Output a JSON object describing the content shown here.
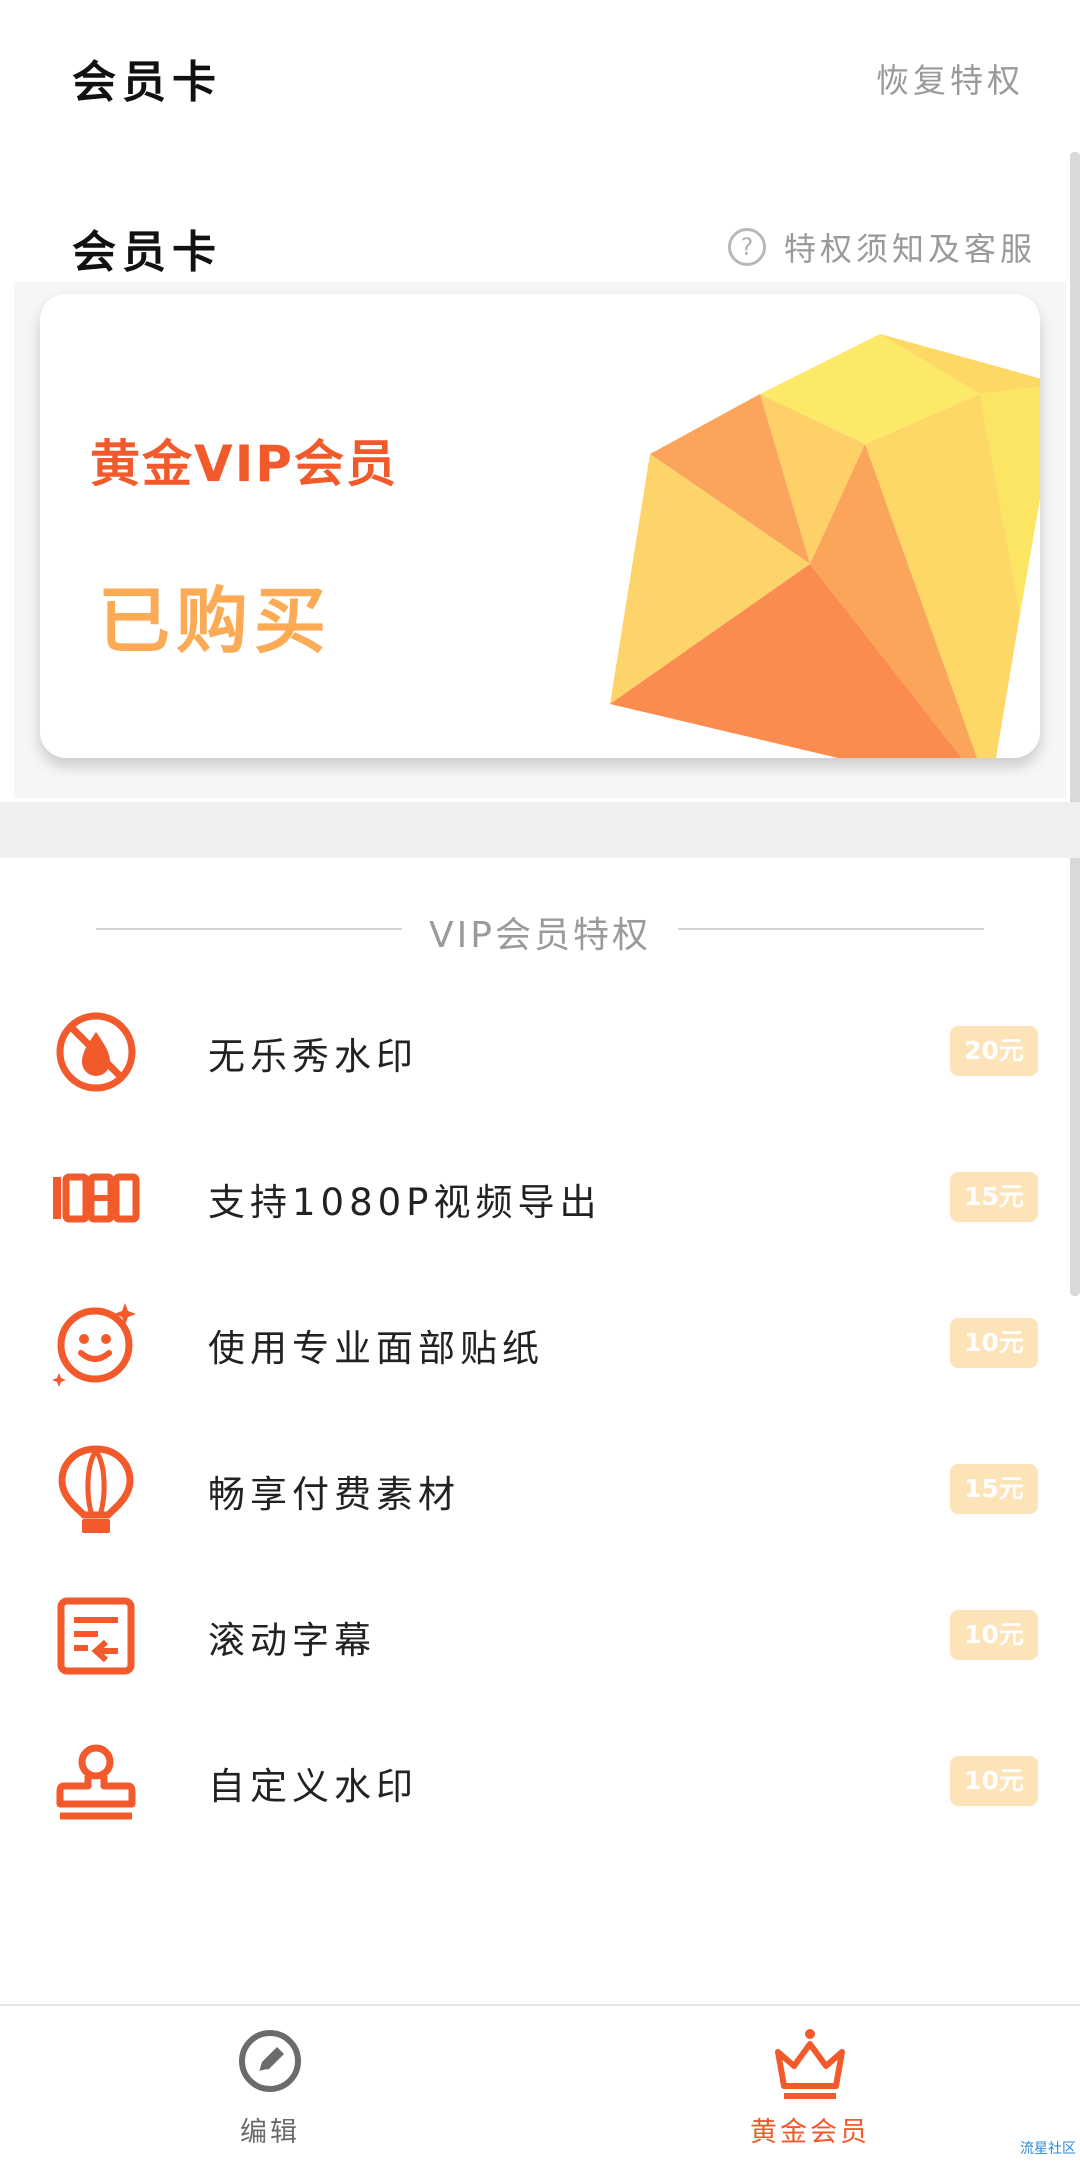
{
  "header": {
    "title": "会员卡",
    "restore_label": "恢复特权"
  },
  "section": {
    "title": "会员卡",
    "help_label": "特权须知及客服"
  },
  "card": {
    "vip_name": "黄金VIP会员",
    "status": "已购买"
  },
  "privileges": {
    "title": "VIP会员特权",
    "items": [
      {
        "icon": "no-watermark-icon",
        "label": "无乐秀水印",
        "price": "20元"
      },
      {
        "icon": "1080-icon",
        "label": "支持1080P视频导出",
        "price": "15元"
      },
      {
        "icon": "face-sticker-icon",
        "label": "使用专业面部贴纸",
        "price": "10元"
      },
      {
        "icon": "balloon-icon",
        "label": "畅享付费素材",
        "price": "15元"
      },
      {
        "icon": "scroll-subtitle-icon",
        "label": "滚动字幕",
        "price": "10元"
      },
      {
        "icon": "stamp-icon",
        "label": "自定义水印",
        "price": "10元"
      }
    ]
  },
  "bottom_nav": {
    "edit_label": "编辑",
    "vip_label": "黄金会员"
  },
  "colors": {
    "accent": "#f25a2c",
    "gold": "#fbab56",
    "price_badge": "#fde3b8"
  },
  "watermark": "流星社区"
}
